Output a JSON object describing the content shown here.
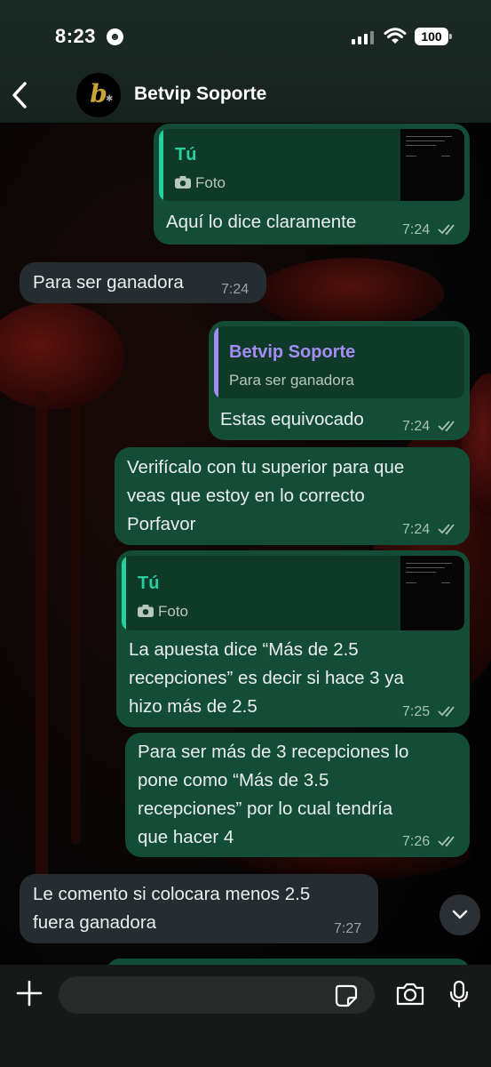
{
  "status_bar": {
    "time": "8:23",
    "emoji": "☻",
    "battery": "100"
  },
  "header": {
    "contact_name": "Betvip Soporte",
    "avatar_letter": "b"
  },
  "messages": [
    {
      "direction": "out",
      "reply_to": {
        "name": "Tú",
        "snippet": "Foto"
      },
      "text": "Aquí lo dice claramente",
      "time": "7:24",
      "read": true
    },
    {
      "direction": "in",
      "text": "Para ser ganadora",
      "time": "7:24"
    },
    {
      "direction": "out",
      "reply_to": {
        "name": "Betvip Soporte",
        "snippet": "Para ser ganadora"
      },
      "text": "Estas equivocado",
      "time": "7:24",
      "read": true
    },
    {
      "direction": "out",
      "text": "Verifícalo con tu superior para que\nveas que estoy en lo correcto\nPorfavor",
      "time": "7:24",
      "read": true
    },
    {
      "direction": "out",
      "reply_to": {
        "name": "Tú",
        "snippet": "Foto"
      },
      "text": "La apuesta dice “Más de 2.5\nrecepciones” es decir si hace 3 ya\nhizo más de 2.5",
      "time": "7:25",
      "read": true
    },
    {
      "direction": "out",
      "text": "Para ser más de 3 recepciones lo\npone como “Más de 3.5\nrecepciones” por lo cual tendría\nque hacer 4",
      "time": "7:26",
      "read": true
    },
    {
      "direction": "in",
      "text": "Le comento si colocara menos  2.5\nfuera ganadora",
      "time": "7:27"
    }
  ],
  "colors": {
    "outgoing_bubble": "#144d37",
    "incoming_bubble": "#262d31",
    "reply_self": "#25d0a0",
    "reply_contact": "#a58cf5"
  },
  "icons": [
    "back-arrow-icon",
    "camera-icon",
    "double-check-icon",
    "chevron-down-icon",
    "plus-icon",
    "sticker-icon",
    "camera-icon",
    "microphone-icon"
  ]
}
